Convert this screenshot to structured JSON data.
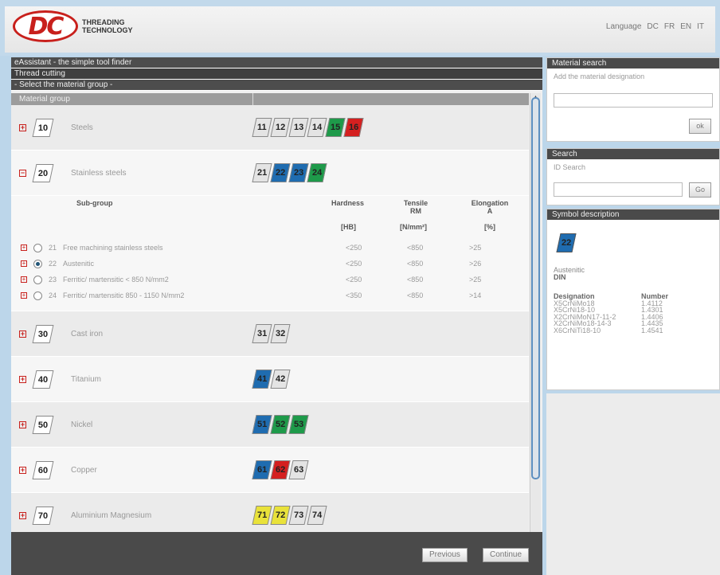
{
  "header": {
    "logo_mark": "DC",
    "logo_line1": "THREADING",
    "logo_line2": "TECHNOLOGY",
    "language_label": "Language",
    "languages": [
      "DC",
      "FR",
      "EN",
      "IT"
    ]
  },
  "main": {
    "title1": "eAssistant - the simple tool finder",
    "title2": "Thread cutting",
    "title3": "- Select the material group -",
    "list_header": "Material group",
    "groups": [
      {
        "code": "10",
        "name": "Steels",
        "tiles": [
          {
            "code": "11",
            "color": "#e4e4e4"
          },
          {
            "code": "12",
            "color": "#e4e4e4"
          },
          {
            "code": "13",
            "color": "#e4e4e4"
          },
          {
            "code": "14",
            "color": "#e4e4e4"
          },
          {
            "code": "15",
            "color": "#1e9a4a"
          },
          {
            "code": "16",
            "color": "#d42020"
          }
        ]
      },
      {
        "code": "20",
        "name": "Stainless steels",
        "tiles": [
          {
            "code": "21",
            "color": "#e4e4e4"
          },
          {
            "code": "22",
            "color": "#1f6cb0"
          },
          {
            "code": "23",
            "color": "#1f6cb0"
          },
          {
            "code": "24",
            "color": "#1e9a4a"
          }
        ]
      },
      {
        "code": "30",
        "name": "Cast iron",
        "tiles": [
          {
            "code": "31",
            "color": "#e4e4e4"
          },
          {
            "code": "32",
            "color": "#e4e4e4"
          }
        ]
      },
      {
        "code": "40",
        "name": "Titanium",
        "tiles": [
          {
            "code": "41",
            "color": "#1f6cb0"
          },
          {
            "code": "42",
            "color": "#e4e4e4"
          }
        ]
      },
      {
        "code": "50",
        "name": "Nickel",
        "tiles": [
          {
            "code": "51",
            "color": "#1f6cb0"
          },
          {
            "code": "52",
            "color": "#1e9a4a"
          },
          {
            "code": "53",
            "color": "#1e9a4a"
          }
        ]
      },
      {
        "code": "60",
        "name": "Copper",
        "tiles": [
          {
            "code": "61",
            "color": "#1f6cb0"
          },
          {
            "code": "62",
            "color": "#d42020"
          },
          {
            "code": "63",
            "color": "#e4e4e4"
          }
        ]
      },
      {
        "code": "70",
        "name": "Aluminium Magnesium",
        "tiles": [
          {
            "code": "71",
            "color": "#e9e23a"
          },
          {
            "code": "72",
            "color": "#e9e23a"
          },
          {
            "code": "73",
            "color": "#e4e4e4"
          },
          {
            "code": "74",
            "color": "#e4e4e4"
          }
        ]
      }
    ],
    "subgroup": {
      "col_subgroup": "Sub-group",
      "col_hardness": "Hardness",
      "col_tensile": "Tensile\nRM\n[N/mm²]",
      "col_tensile_l1": "Tensile",
      "col_tensile_l2": "RM",
      "col_elong_l1": "Elongation",
      "col_elong_l2": "A",
      "unit_hardness": "[HB]",
      "unit_tensile": "[N/mm²]",
      "unit_elong": "[%]",
      "rows": [
        {
          "num": "21",
          "name": "Free machining stainless steels",
          "hb": "<250",
          "rm": "<850",
          "a": ">25",
          "selected": false
        },
        {
          "num": "22",
          "name": "Austenitic",
          "hb": "<250",
          "rm": "<850",
          "a": ">26",
          "selected": true
        },
        {
          "num": "23",
          "name": "Ferritic/ martensitic < 850 N/mm2",
          "hb": "<250",
          "rm": "<850",
          "a": ">25",
          "selected": false
        },
        {
          "num": "24",
          "name": "Ferritic/ martensitic 850 - 1150 N/mm2",
          "hb": "<350",
          "rm": "<850",
          "a": ">14",
          "selected": false
        }
      ]
    }
  },
  "footer": {
    "previous": "Previous",
    "continue": "Continue"
  },
  "material_search": {
    "title": "Material search",
    "label": "Add the material designation",
    "button": "ok"
  },
  "search": {
    "title": "Search",
    "label": "ID Search",
    "button": "Go"
  },
  "symbol": {
    "title": "Symbol description",
    "tile_code": "22",
    "tile_color": "#1f6cb0",
    "line1": "Austenitic",
    "line2": "DIN",
    "col_designation": "Designation",
    "col_number": "Number",
    "rows": [
      {
        "d": "X5CrNiMo18",
        "n": "1.4112"
      },
      {
        "d": "X5CrNi18-10",
        "n": "1.4301"
      },
      {
        "d": "X2CrNiMoN17-11-2",
        "n": "1.4406"
      },
      {
        "d": "X2CrNiMo18-14-3",
        "n": "1.4435"
      },
      {
        "d": "X6CrNiTi18-10",
        "n": "1.4541"
      }
    ]
  }
}
